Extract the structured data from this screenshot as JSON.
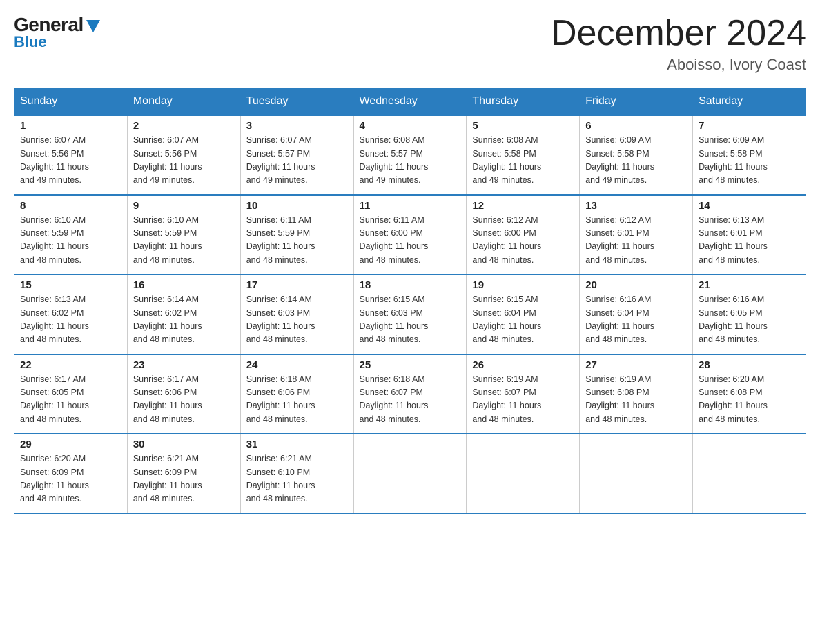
{
  "header": {
    "logo_general": "General",
    "logo_blue": "Blue",
    "month_title": "December 2024",
    "location": "Aboisso, Ivory Coast"
  },
  "weekdays": [
    "Sunday",
    "Monday",
    "Tuesday",
    "Wednesday",
    "Thursday",
    "Friday",
    "Saturday"
  ],
  "weeks": [
    [
      {
        "day": "1",
        "sunrise": "6:07 AM",
        "sunset": "5:56 PM",
        "daylight": "11 hours and 49 minutes."
      },
      {
        "day": "2",
        "sunrise": "6:07 AM",
        "sunset": "5:56 PM",
        "daylight": "11 hours and 49 minutes."
      },
      {
        "day": "3",
        "sunrise": "6:07 AM",
        "sunset": "5:57 PM",
        "daylight": "11 hours and 49 minutes."
      },
      {
        "day": "4",
        "sunrise": "6:08 AM",
        "sunset": "5:57 PM",
        "daylight": "11 hours and 49 minutes."
      },
      {
        "day": "5",
        "sunrise": "6:08 AM",
        "sunset": "5:58 PM",
        "daylight": "11 hours and 49 minutes."
      },
      {
        "day": "6",
        "sunrise": "6:09 AM",
        "sunset": "5:58 PM",
        "daylight": "11 hours and 49 minutes."
      },
      {
        "day": "7",
        "sunrise": "6:09 AM",
        "sunset": "5:58 PM",
        "daylight": "11 hours and 48 minutes."
      }
    ],
    [
      {
        "day": "8",
        "sunrise": "6:10 AM",
        "sunset": "5:59 PM",
        "daylight": "11 hours and 48 minutes."
      },
      {
        "day": "9",
        "sunrise": "6:10 AM",
        "sunset": "5:59 PM",
        "daylight": "11 hours and 48 minutes."
      },
      {
        "day": "10",
        "sunrise": "6:11 AM",
        "sunset": "5:59 PM",
        "daylight": "11 hours and 48 minutes."
      },
      {
        "day": "11",
        "sunrise": "6:11 AM",
        "sunset": "6:00 PM",
        "daylight": "11 hours and 48 minutes."
      },
      {
        "day": "12",
        "sunrise": "6:12 AM",
        "sunset": "6:00 PM",
        "daylight": "11 hours and 48 minutes."
      },
      {
        "day": "13",
        "sunrise": "6:12 AM",
        "sunset": "6:01 PM",
        "daylight": "11 hours and 48 minutes."
      },
      {
        "day": "14",
        "sunrise": "6:13 AM",
        "sunset": "6:01 PM",
        "daylight": "11 hours and 48 minutes."
      }
    ],
    [
      {
        "day": "15",
        "sunrise": "6:13 AM",
        "sunset": "6:02 PM",
        "daylight": "11 hours and 48 minutes."
      },
      {
        "day": "16",
        "sunrise": "6:14 AM",
        "sunset": "6:02 PM",
        "daylight": "11 hours and 48 minutes."
      },
      {
        "day": "17",
        "sunrise": "6:14 AM",
        "sunset": "6:03 PM",
        "daylight": "11 hours and 48 minutes."
      },
      {
        "day": "18",
        "sunrise": "6:15 AM",
        "sunset": "6:03 PM",
        "daylight": "11 hours and 48 minutes."
      },
      {
        "day": "19",
        "sunrise": "6:15 AM",
        "sunset": "6:04 PM",
        "daylight": "11 hours and 48 minutes."
      },
      {
        "day": "20",
        "sunrise": "6:16 AM",
        "sunset": "6:04 PM",
        "daylight": "11 hours and 48 minutes."
      },
      {
        "day": "21",
        "sunrise": "6:16 AM",
        "sunset": "6:05 PM",
        "daylight": "11 hours and 48 minutes."
      }
    ],
    [
      {
        "day": "22",
        "sunrise": "6:17 AM",
        "sunset": "6:05 PM",
        "daylight": "11 hours and 48 minutes."
      },
      {
        "day": "23",
        "sunrise": "6:17 AM",
        "sunset": "6:06 PM",
        "daylight": "11 hours and 48 minutes."
      },
      {
        "day": "24",
        "sunrise": "6:18 AM",
        "sunset": "6:06 PM",
        "daylight": "11 hours and 48 minutes."
      },
      {
        "day": "25",
        "sunrise": "6:18 AM",
        "sunset": "6:07 PM",
        "daylight": "11 hours and 48 minutes."
      },
      {
        "day": "26",
        "sunrise": "6:19 AM",
        "sunset": "6:07 PM",
        "daylight": "11 hours and 48 minutes."
      },
      {
        "day": "27",
        "sunrise": "6:19 AM",
        "sunset": "6:08 PM",
        "daylight": "11 hours and 48 minutes."
      },
      {
        "day": "28",
        "sunrise": "6:20 AM",
        "sunset": "6:08 PM",
        "daylight": "11 hours and 48 minutes."
      }
    ],
    [
      {
        "day": "29",
        "sunrise": "6:20 AM",
        "sunset": "6:09 PM",
        "daylight": "11 hours and 48 minutes."
      },
      {
        "day": "30",
        "sunrise": "6:21 AM",
        "sunset": "6:09 PM",
        "daylight": "11 hours and 48 minutes."
      },
      {
        "day": "31",
        "sunrise": "6:21 AM",
        "sunset": "6:10 PM",
        "daylight": "11 hours and 48 minutes."
      },
      null,
      null,
      null,
      null
    ]
  ],
  "labels": {
    "sunrise": "Sunrise:",
    "sunset": "Sunset:",
    "daylight": "Daylight:"
  }
}
